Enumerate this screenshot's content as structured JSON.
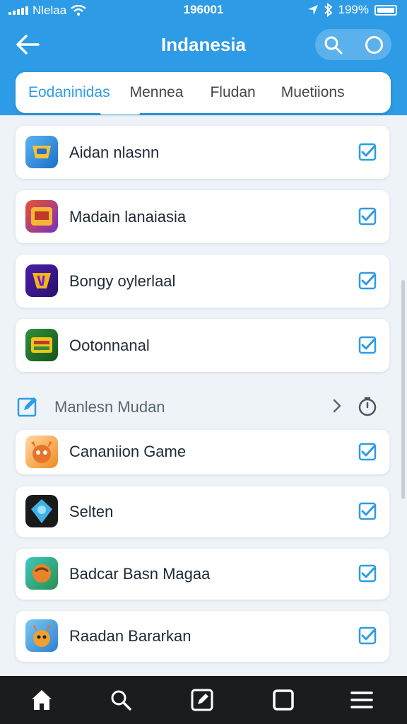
{
  "status_bar": {
    "carrier": "Nlelaa",
    "time": "196001",
    "battery": "199%",
    "icons": [
      "signal-icon",
      "wifi-icon",
      "location-icon",
      "bluetooth-icon",
      "battery-icon"
    ]
  },
  "header": {
    "title": "Indanesia",
    "icons": [
      "back-arrow-icon",
      "search-icon",
      "circle-icon"
    ]
  },
  "tabs": [
    {
      "label": "Eodaninidas",
      "active": true
    },
    {
      "label": "Mennea",
      "active": false
    },
    {
      "label": "Fludan",
      "active": false
    },
    {
      "label": "Muetiions",
      "active": false
    }
  ],
  "apps_top": [
    {
      "name": "Aidan nlasnn",
      "checked": true
    },
    {
      "name": "Madain lanaiasia",
      "checked": true
    },
    {
      "name": "Bongy oylerlaal",
      "checked": true
    },
    {
      "name": "Ootonnanal",
      "checked": true
    }
  ],
  "section": {
    "label": "Manlesn Mudan",
    "icons": [
      "edit-icon",
      "chevron-right-icon",
      "timer-icon"
    ]
  },
  "apps_bottom": [
    {
      "name": "Cananiion Game",
      "checked": true
    },
    {
      "name": "Selten",
      "checked": true
    },
    {
      "name": "Badcar Basn Magaa",
      "checked": true
    },
    {
      "name": "Raadan Bararkan",
      "checked": true
    }
  ],
  "bottom_nav": [
    "home-icon",
    "search-icon",
    "edit-icon",
    "square-icon",
    "menu-icon"
  ],
  "colors": {
    "accent": "#2d9be6",
    "nav": "#1b1c1e",
    "background": "#eef3f8"
  }
}
